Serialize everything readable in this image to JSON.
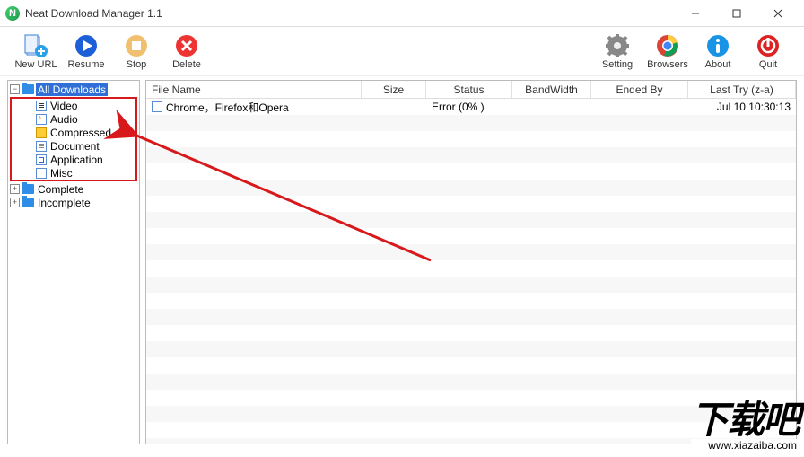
{
  "window": {
    "title": "Neat Download Manager 1.1"
  },
  "toolbar": {
    "left": [
      {
        "key": "new-url",
        "label": "New URL"
      },
      {
        "key": "resume",
        "label": "Resume"
      },
      {
        "key": "stop",
        "label": "Stop"
      },
      {
        "key": "delete",
        "label": "Delete"
      }
    ],
    "right": [
      {
        "key": "setting",
        "label": "Setting"
      },
      {
        "key": "browsers",
        "label": "Browsers"
      },
      {
        "key": "about",
        "label": "About"
      },
      {
        "key": "quit",
        "label": "Quit"
      }
    ]
  },
  "sidebar": {
    "root": {
      "label": "All Downloads",
      "children": [
        {
          "label": "Video",
          "icon": "video"
        },
        {
          "label": "Audio",
          "icon": "audio"
        },
        {
          "label": "Compressed",
          "icon": "compressed"
        },
        {
          "label": "Document",
          "icon": "doc"
        },
        {
          "label": "Application",
          "icon": "app"
        },
        {
          "label": "Misc",
          "icon": "misc"
        }
      ]
    },
    "other": [
      {
        "label": "Complete"
      },
      {
        "label": "Incomplete"
      }
    ]
  },
  "columns": {
    "file_name": "File Name",
    "size": "Size",
    "status": "Status",
    "bandwidth": "BandWidth",
    "ended_by": "Ended By",
    "last_try": "Last Try (z-a)"
  },
  "rows": [
    {
      "file_name": "Chrome，Firefox和Opera",
      "size": "",
      "status": "Error (0% )",
      "bandwidth": "",
      "ended_by": "",
      "last_try": "Jul 10  10:30:13"
    }
  ],
  "watermark": {
    "text": "下载吧",
    "url": "www.xiazaiba.com"
  }
}
